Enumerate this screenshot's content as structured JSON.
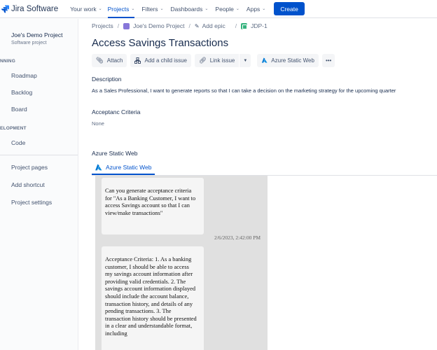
{
  "topnav": {
    "app_name": "Jira Software",
    "items": [
      "Your work",
      "Projects",
      "Filters",
      "Dashboards",
      "People",
      "Apps"
    ],
    "create_label": "Create",
    "brand_color": "#0052cc"
  },
  "sidebar": {
    "project_name": "Joe's Demo Project",
    "project_type": "Software project",
    "planning_label": "NNING",
    "planning_items": [
      "Roadmap",
      "Backlog",
      "Board"
    ],
    "development_label": "ELOPMENT",
    "development_items": [
      "Code"
    ],
    "footer_items": [
      "Project pages",
      "Add shortcut",
      "Project settings"
    ]
  },
  "breadcrumb": {
    "projects": "Projects",
    "project": "Joe's Demo Project",
    "epic": "Add epic",
    "issue_key": "JDP-1"
  },
  "issue": {
    "title": "Access Savings Transactions",
    "toolbar": {
      "attach": "Attach",
      "add_child": "Add a child issue",
      "link_issue": "Link issue",
      "azure": "Azure Static Web",
      "more": "•••"
    },
    "description_label": "Description",
    "description": "As a Sales Professional, I want to generate reports so that I can take a decision on the marketing strategy for the upcoming quarter",
    "acceptance_label": "Acceptanc Criteria",
    "acceptance_value": "None",
    "azure_label": "Azure Static Web",
    "azure_tab": "Azure Static Web"
  },
  "chat": {
    "message1": "Can you generate acceptance criteria for \"As a Banking Customer, I want to access Savings account so that I can view/make transactions\"",
    "timestamp": "2/6/2023, 2:42:00 PM",
    "message2": "Acceptance Criteria: 1. As a banking customer, I should be able to access my savings account information after providing valid credentials. 2. The savings account information displayed should include the account balance, transaction history, and details of any pending transactions. 3. The transaction history should be presented in a clear and understandable format, including"
  }
}
